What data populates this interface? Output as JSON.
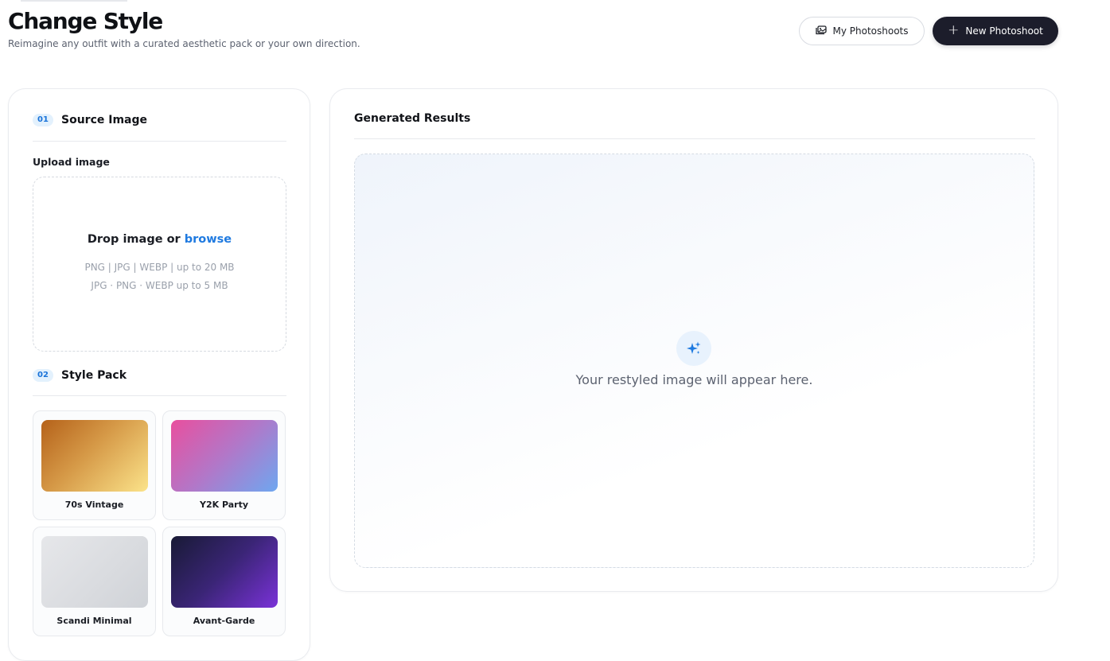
{
  "header": {
    "title": "Change Style",
    "subtitle": "Reimagine any outfit with a curated aesthetic pack or your own direction.",
    "my_photoshoots_label": "My Photoshoots",
    "new_photoshoot_label": "New Photoshoot"
  },
  "source": {
    "step": "01",
    "title": "Source Image",
    "upload_label": "Upload image",
    "drop_text": "Drop image or ",
    "browse_text": "browse",
    "hint_line1": "PNG | JPG | WEBP | up to 20 MB",
    "hint_line2": "JPG · PNG · WEBP up to 5 MB"
  },
  "style_pack": {
    "step": "02",
    "title": "Style Pack",
    "items": [
      {
        "label": "70s Vintage",
        "colors": [
          "#b5621a",
          "#fbe38a"
        ]
      },
      {
        "label": "Y2K Party",
        "colors": [
          "#e94f9e",
          "#6ea7f0"
        ]
      },
      {
        "label": "Scandi Minimal",
        "colors": [
          "#e6e7ea",
          "#cfd2d7"
        ]
      },
      {
        "label": "Avant-Garde",
        "colors": [
          "#181a35",
          "#7a32d8"
        ]
      }
    ]
  },
  "results": {
    "title": "Generated Results",
    "placeholder": "Your restyled image will appear here."
  },
  "colors": {
    "accent": "#1f7ae0",
    "dark_button": "#1c1d2b"
  }
}
